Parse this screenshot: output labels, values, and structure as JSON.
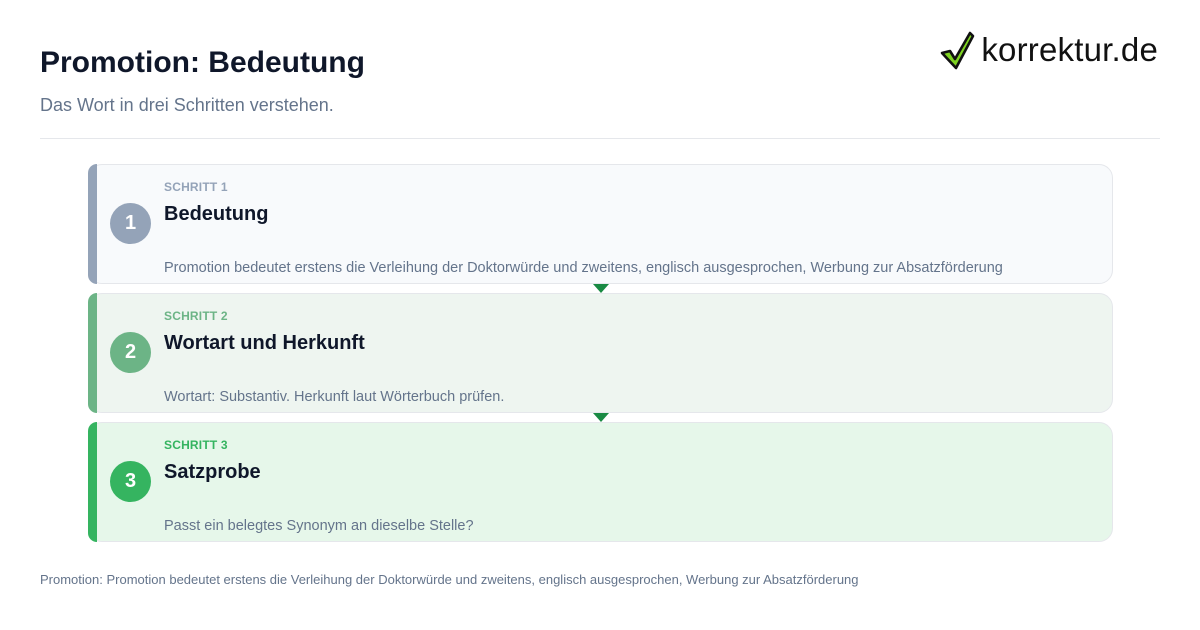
{
  "header": {
    "title": "Promotion: Bedeutung",
    "subtitle": "Das Wort in drei Schritten verstehen."
  },
  "brand": {
    "name": "korrektur.de",
    "icon": "check-mark-icon",
    "icon_color": "#7ed321"
  },
  "steps": [
    {
      "kicker": "SCHRITT 1",
      "number": "1",
      "title": "Bedeutung",
      "text": "Promotion bedeutet erstens die Verleihung der Doktorwürde und zweitens, englisch ausgesprochen, Werbung zur Absatzförderung",
      "color": "#94a3b8"
    },
    {
      "kicker": "SCHRITT 2",
      "number": "2",
      "title": "Wortart und Herkunft",
      "text": "Wortart: Substantiv. Herkunft laut Wörterbuch prüfen.",
      "color": "#6cb486"
    },
    {
      "kicker": "SCHRITT 3",
      "number": "3",
      "title": "Satzprobe",
      "text": "Passt ein belegtes Synonym an dieselbe Stelle?",
      "color": "#35b460"
    }
  ],
  "connector_color": "#198a43",
  "footer": {
    "note": "Promotion: Promotion bedeutet erstens die Verleihung der Doktorwürde und zweitens, englisch ausgesprochen, Werbung zur Absatzförderung"
  }
}
